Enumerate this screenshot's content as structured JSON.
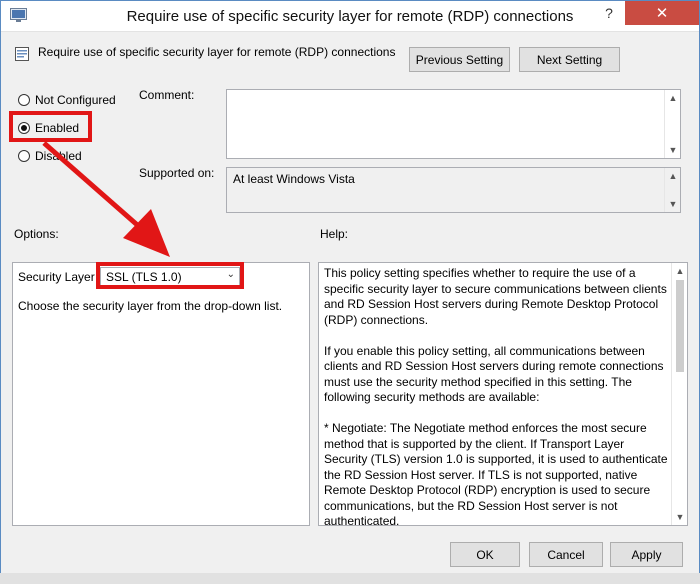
{
  "window": {
    "title": "Require use of specific security layer for remote (RDP) connections",
    "help_glyph": "?",
    "close_glyph": "✕"
  },
  "header": {
    "policy_name": "Require use of specific security layer for remote (RDP) connections",
    "prev_button": "Previous Setting",
    "next_button": "Next Setting"
  },
  "state": {
    "options": [
      {
        "label": "Not Configured",
        "selected": false
      },
      {
        "label": "Enabled",
        "selected": true
      },
      {
        "label": "Disabled",
        "selected": false
      }
    ]
  },
  "comment": {
    "label": "Comment:",
    "value": ""
  },
  "supported": {
    "label": "Supported on:",
    "value": "At least Windows Vista"
  },
  "options_section": {
    "header": "Options:",
    "security_layer_label": "Security Layer",
    "security_layer_value": "SSL (TLS 1.0)",
    "description": "Choose the security layer from the drop-down list."
  },
  "help_section": {
    "header": "Help:",
    "paragraphs": [
      "This policy setting specifies whether to require the use of a specific security layer to secure communications between clients and RD Session Host servers during Remote Desktop Protocol (RDP) connections.",
      "If you enable this policy setting, all communications between clients and RD Session Host servers during remote connections must use the security method specified in this setting. The following security methods are available:",
      "* Negotiate: The Negotiate method enforces the most secure method that is supported by the client. If Transport Layer Security (TLS) version 1.0 is supported, it is used to authenticate the RD Session Host server. If TLS is not supported, native Remote Desktop Protocol (RDP) encryption is used to secure communications, but the RD Session Host server is not authenticated."
    ]
  },
  "footer": {
    "ok": "OK",
    "cancel": "Cancel",
    "apply": "Apply"
  },
  "colors": {
    "highlight": "#e11616",
    "close_button": "#c94c42"
  },
  "icons": {
    "app": "policy-editor-icon",
    "policy": "policy-setting-icon"
  }
}
